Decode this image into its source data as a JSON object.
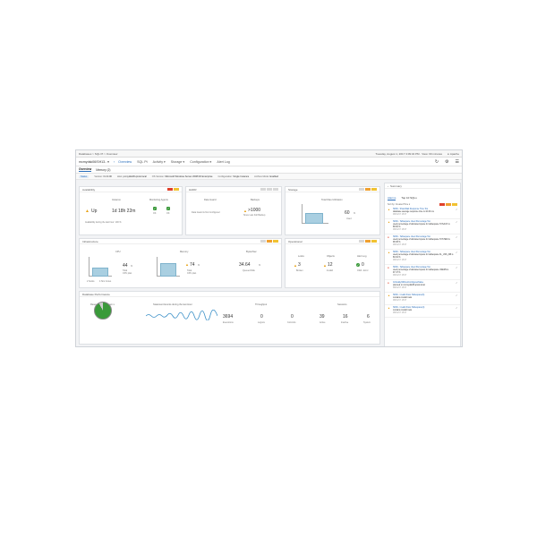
{
  "topbar": {
    "breadcrumb": "Databases > SQL Pt > Overview",
    "datetime": "Tuesday, August 1, 2017 3:09:34 PM · View: 60 minutes",
    "user": "Apache"
  },
  "navbar": {
    "instance": "mcmydsk06\\SH13.. ▾",
    "items": [
      "Overview",
      "SQL Pt",
      "Activity ▾",
      "Storage ▾",
      "Configuration ▾",
      "Alert Log"
    ]
  },
  "subtabs": [
    "Overview",
    "Memory (2)"
  ],
  "infobar": {
    "status": "Status",
    "version_label": "Version:",
    "version_value": "6.2.9.00",
    "host_label": "Host:",
    "host_value": "pcmydsk06.qmsk.local",
    "os_label": "OS Version:",
    "os_value": "Microsoft Windows Server 2008 R2 Enterprise",
    "config_label": "Configuration:",
    "config_value": "Single Instance",
    "archive_label": "Archive Mode:",
    "archive_value": "Enabled"
  },
  "availability": {
    "title": "Availability",
    "instance_label": "Instance",
    "up_label": "Up",
    "uptime": "1d 18h 22m",
    "agents_label": "Monitoring Agents",
    "agent_a": "OK",
    "agent_b": "OK",
    "availability_text": "Availability during the last hour: 100 %"
  },
  "hadr": {
    "title": "HADR",
    "state_label": "Data Guard",
    "state_value": "Data Guard is Not Configured",
    "backups_label": "Backups",
    "backups_value": ">1000",
    "backups_sub": "Since Last Full Backup"
  },
  "storage": {
    "title": "Storage",
    "files_label": "Total Files Utilization",
    "files_value": "60",
    "files_unit": "%",
    "files_sub": "Used"
  },
  "infrastructure": {
    "title": "Infrastructure",
    "cpu_label": "CPU",
    "cpu_value": "44",
    "cpu_unit": "%",
    "cpu_sub": "Total",
    "cpu_sub2": "CPU plan",
    "cpu_sockets": "2 Socks",
    "cpu_cores": "4 Sim Cores",
    "memory_label": "Memory",
    "memory_value": "74",
    "memory_unit": "%",
    "memory_sub": "Total",
    "memory_sub2": "CPU plan",
    "bytes_label": "Bytes/Sec",
    "bytes_value": "34.64",
    "bytes_unit": "%",
    "bytes_sub": "Queued Disk"
  },
  "operational": {
    "title": "Operational",
    "locks_label": "Locks",
    "locks_value": "3",
    "locks_sub": "Broken",
    "jobs_label": "Objects",
    "jobs_value": "12",
    "jobs_sub": "Invalid",
    "alert_label": "Alert Log",
    "alert_value": "0",
    "alert_sub": "ORA - Error"
  },
  "performance": {
    "title": "Database Performance",
    "breakdown_label": "Resource Breakdown ▾",
    "wait_label": "Statement Events during the last Hour",
    "throughput_label": "Throughput",
    "sessions_label": "Sessions",
    "executions_value": "3694",
    "executions_label": "Executions",
    "logons_value": "0",
    "logons_label": "Logons",
    "commits_value": "0",
    "commits_label": "Commits",
    "active_value": "39",
    "active_label": "Active",
    "inactive_value": "16",
    "inactive_label": "Inactive",
    "system_value": "6",
    "system_label": "System"
  },
  "summary": {
    "title": "Summary",
    "tabs": [
      "Alarms",
      "Top 10 SQLs"
    ],
    "sort_label": "Sort by: Created Time ▾",
    "alarms": [
      {
        "title": "SMSI - ShareWait Response Time Too",
        "body": "database average response time is 10.03 ms",
        "date": "08/01/17 15:07"
      },
      {
        "title": "SMSI - Tablespace Used Percentage Too",
        "body": "used percentage of allocated space for tablespace SYSAUX is 88.60 %",
        "date": "08/01/17 15:07"
      },
      {
        "title": "SMSI - Tablespace Used Percentage Too",
        "body": "used percentage of allocated space for tablespace SYSTEM is 98.38 %",
        "date": "08/01/17 15:07"
      },
      {
        "title": "SMSI - Tablespace Used Percentage Too",
        "body": "used percentage of allocated space for tablespace FL_USS_DB is 80.94 %",
        "date": "08/01/17 15:07"
      },
      {
        "title": "SMSI - Tablespace Used Percentage Too",
        "body": "used percentage of allocated space for tablespace USERS is 97.47 %",
        "date": "08/01/17 15:07"
      },
      {
        "title": "CriticalityWithoutConfiguredValue",
        "body": "planned on mcmydsk06.qmsk.local",
        "date": "08/01/17 15:07"
      },
      {
        "title": "SMSI - Invalid Fiscs Tablespace(6)",
        "body": "contains invalid rows",
        "date": "08/01/17 15:07"
      },
      {
        "title": "SMSI - Invalid Fiscs Tablespace(4)",
        "body": "contains invalid rows",
        "date": "08/01/17 15:07"
      }
    ]
  }
}
